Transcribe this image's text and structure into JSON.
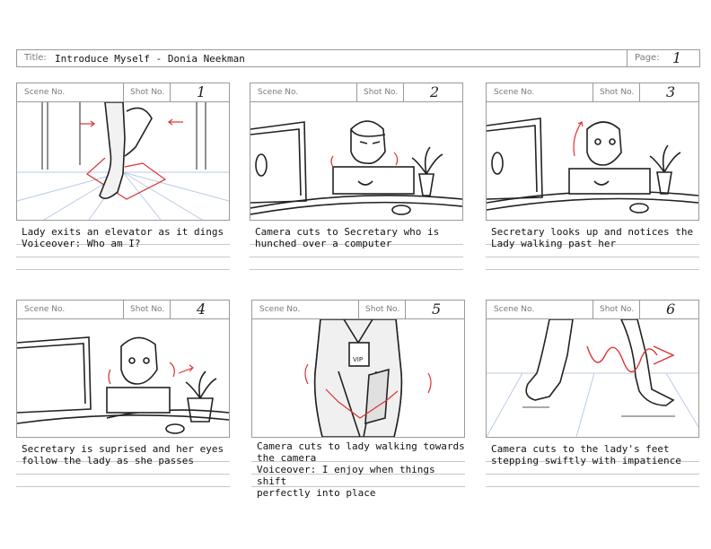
{
  "header": {
    "title_label": "Title:",
    "title_value": "Introduce Myself - Donia Neekman",
    "page_label": "Page:",
    "page_number": "1"
  },
  "panel_labels": {
    "scene": "Scene No.",
    "shot": "Shot No."
  },
  "panels": [
    {
      "shot": "1",
      "description": "Lady exits an elevator as it dings\nVoiceover: Who am I?"
    },
    {
      "shot": "2",
      "description": "Camera cuts to Secretary who is\nhunched over a computer"
    },
    {
      "shot": "3",
      "description": "Secretary looks up and notices the\nLady walking past her"
    },
    {
      "shot": "4",
      "description": "Secretary is suprised and her eyes\nfollow the lady as she passes"
    },
    {
      "shot": "5",
      "description": "Camera cuts to lady walking towards\nthe camera\nVoiceover: I enjoy when things shift\nperfectly into place"
    },
    {
      "shot": "6",
      "description": "Camera cuts to the lady's feet\nstepping swiftly with impatience"
    }
  ],
  "badge_text": "VIP"
}
